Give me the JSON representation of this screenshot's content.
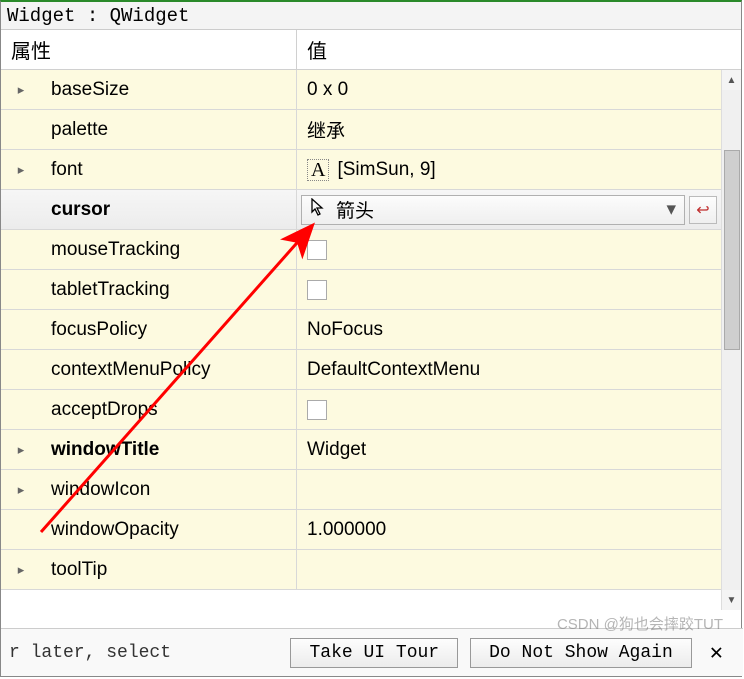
{
  "title_bar": "Widget : QWidget",
  "headers": {
    "prop": "属性",
    "val": "值"
  },
  "rows": [
    {
      "name": "baseSize",
      "value": "0 x 0",
      "expandable": true,
      "bold": false,
      "type": "text"
    },
    {
      "name": "palette",
      "value": "继承",
      "expandable": false,
      "bold": false,
      "type": "text"
    },
    {
      "name": "font",
      "value": "[SimSun, 9]",
      "expandable": true,
      "bold": false,
      "type": "font"
    },
    {
      "name": "cursor",
      "value": "箭头",
      "expandable": false,
      "bold": true,
      "type": "cursor",
      "selected": true
    },
    {
      "name": "mouseTracking",
      "value": "",
      "expandable": false,
      "bold": false,
      "type": "check"
    },
    {
      "name": "tabletTracking",
      "value": "",
      "expandable": false,
      "bold": false,
      "type": "check"
    },
    {
      "name": "focusPolicy",
      "value": "NoFocus",
      "expandable": false,
      "bold": false,
      "type": "text"
    },
    {
      "name": "contextMenuPolicy",
      "value": "DefaultContextMenu",
      "expandable": false,
      "bold": false,
      "type": "text"
    },
    {
      "name": "acceptDrops",
      "value": "",
      "expandable": false,
      "bold": false,
      "type": "check"
    },
    {
      "name": "windowTitle",
      "value": "Widget",
      "expandable": true,
      "bold": true,
      "type": "text"
    },
    {
      "name": "windowIcon",
      "value": "",
      "expandable": true,
      "bold": false,
      "type": "text"
    },
    {
      "name": "windowOpacity",
      "value": "1.000000",
      "expandable": false,
      "bold": false,
      "type": "text"
    },
    {
      "name": "toolTip",
      "value": "",
      "expandable": true,
      "bold": false,
      "type": "text"
    }
  ],
  "footer": {
    "hint": "r later, select",
    "tour_btn": "Take UI Tour",
    "dismiss_btn": "Do Not Show Again"
  },
  "watermark": "CSDN @狗也会摔跤TUT",
  "font_glyph": "A"
}
